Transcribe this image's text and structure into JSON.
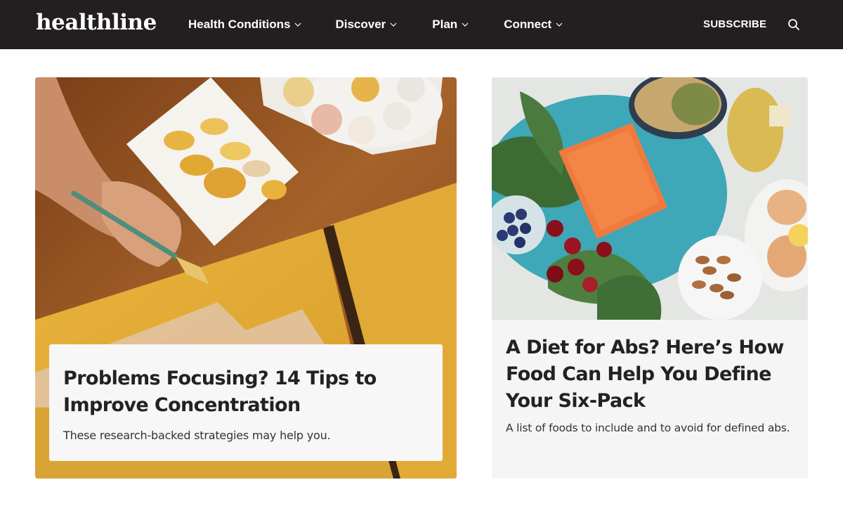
{
  "header": {
    "logo": "healthline",
    "nav": [
      {
        "label": "Health Conditions"
      },
      {
        "label": "Discover"
      },
      {
        "label": "Plan"
      },
      {
        "label": "Connect"
      }
    ],
    "subscribe_label": "SUBSCRIBE",
    "search_icon": "search-icon",
    "background_color": "#231f20"
  },
  "articles": [
    {
      "title": "Problems Focusing? 14 Tips to Improve Concentration",
      "description": "These research-backed strategies may help you.",
      "image": "hand-painting-yellow-canvas-image"
    },
    {
      "title": "A Diet for Abs? Here’s How Food Can Help You Define Your Six-Pack",
      "description": "A list of foods to include and to avoid for defined abs.",
      "image": "salmon-kale-berries-nuts-eggs-image"
    }
  ]
}
